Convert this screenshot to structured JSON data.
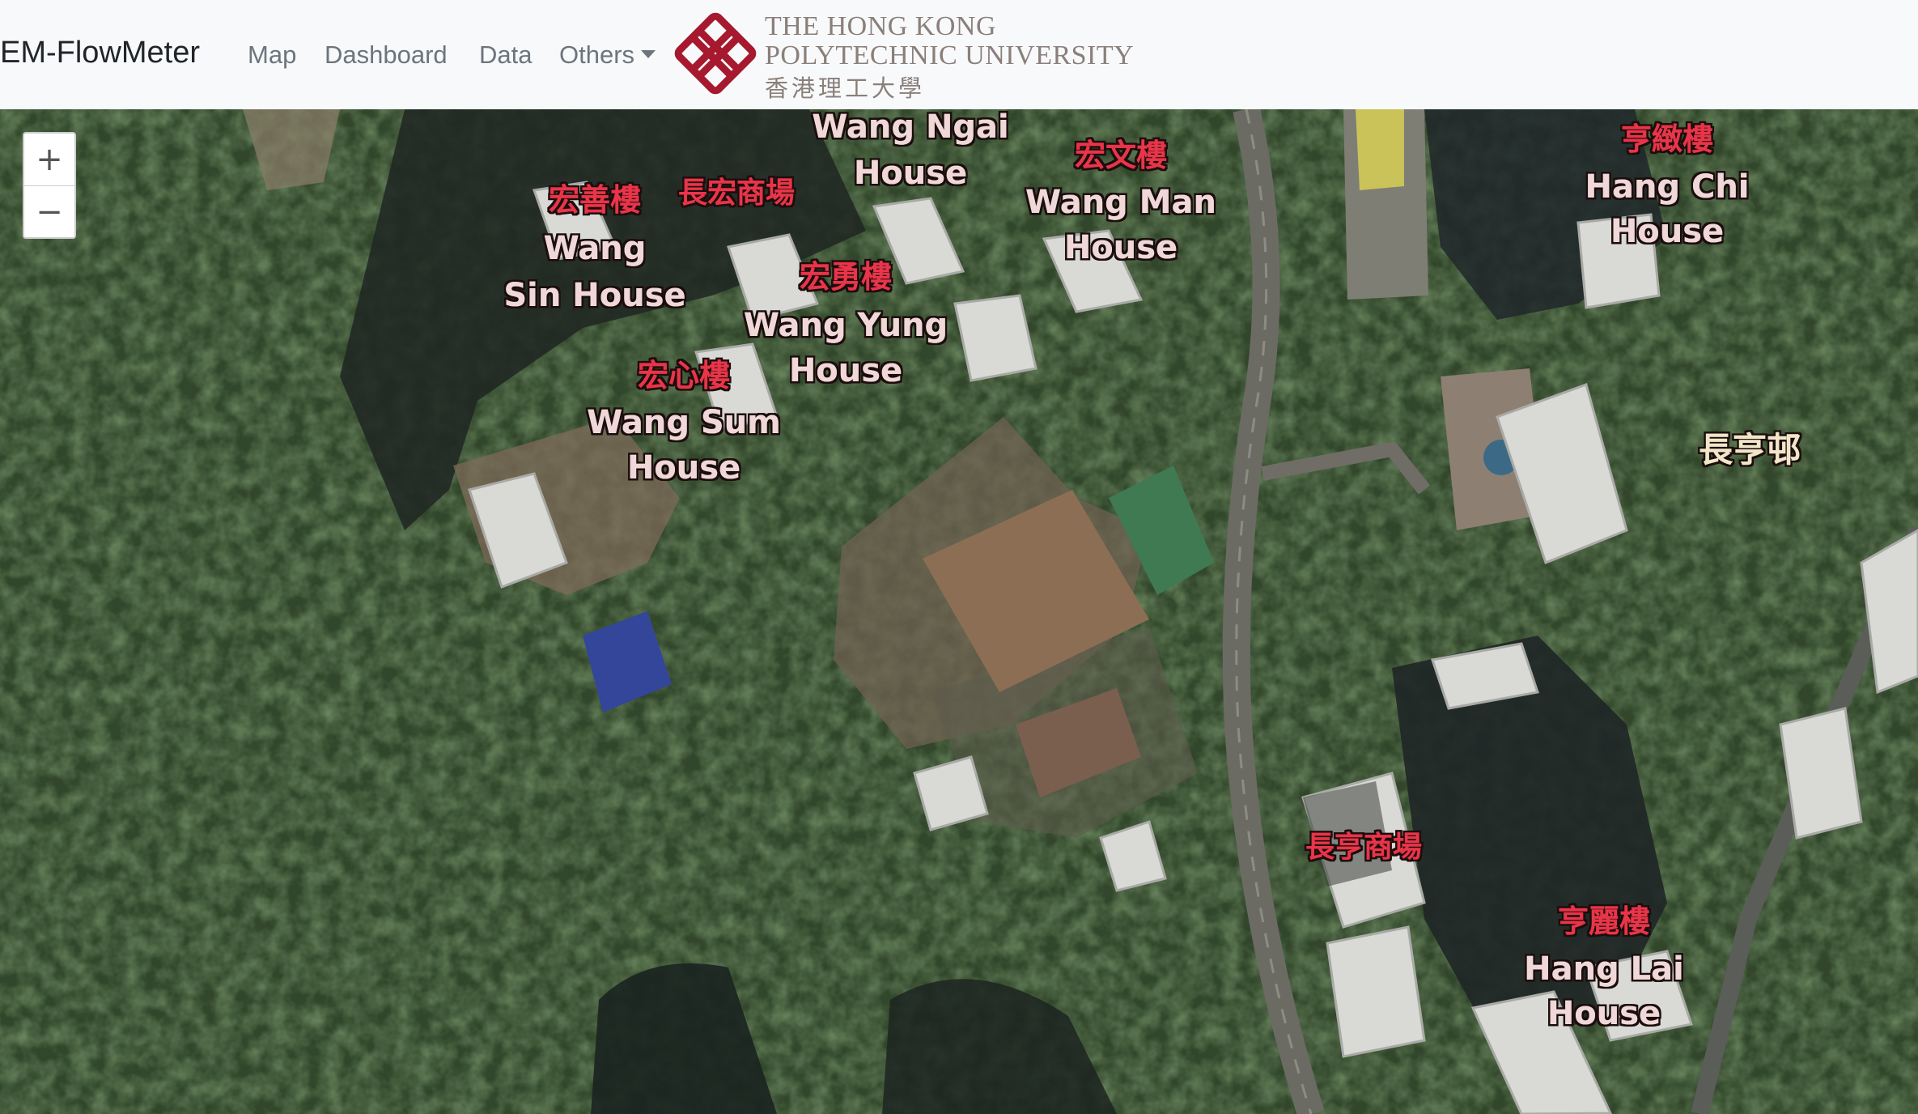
{
  "navbar": {
    "brand": "EM-FlowMeter",
    "links": [
      "Map",
      "Dashboard",
      "Data"
    ],
    "dropdown_label": "Others",
    "logo": {
      "line1": "THE HONG KONG",
      "line2": "POLYTECHNIC UNIVERSITY",
      "line3": "香港理工大學",
      "color": "#a6192e"
    }
  },
  "map": {
    "type": "satellite",
    "zoom_controls": {
      "in": "+",
      "out": "−"
    },
    "labels": [
      {
        "zh": "宏善樓",
        "en": [
          "Wang",
          "Sin House"
        ]
      },
      {
        "zh": "長宏商場",
        "en": []
      },
      {
        "zh": "",
        "en": [
          "Wang Ngai",
          "House"
        ]
      },
      {
        "zh": "宏文樓",
        "en": [
          "Wang Man",
          "House"
        ]
      },
      {
        "zh": "宏勇樓",
        "en": [
          "Wang Yung",
          "House"
        ]
      },
      {
        "zh": "宏心樓",
        "en": [
          "Wang Sum",
          "House"
        ]
      },
      {
        "zh": "亨緻樓",
        "en": [
          "Hang Chi",
          "House"
        ]
      },
      {
        "zh": "長亨邨",
        "en": []
      },
      {
        "zh": "長亨商場",
        "en": []
      },
      {
        "zh": "亨麗樓",
        "en": [
          "Hang Lai",
          "House"
        ]
      }
    ],
    "colors": {
      "building_label": "#e8354a",
      "estate_label": "#f2e6c9"
    }
  }
}
